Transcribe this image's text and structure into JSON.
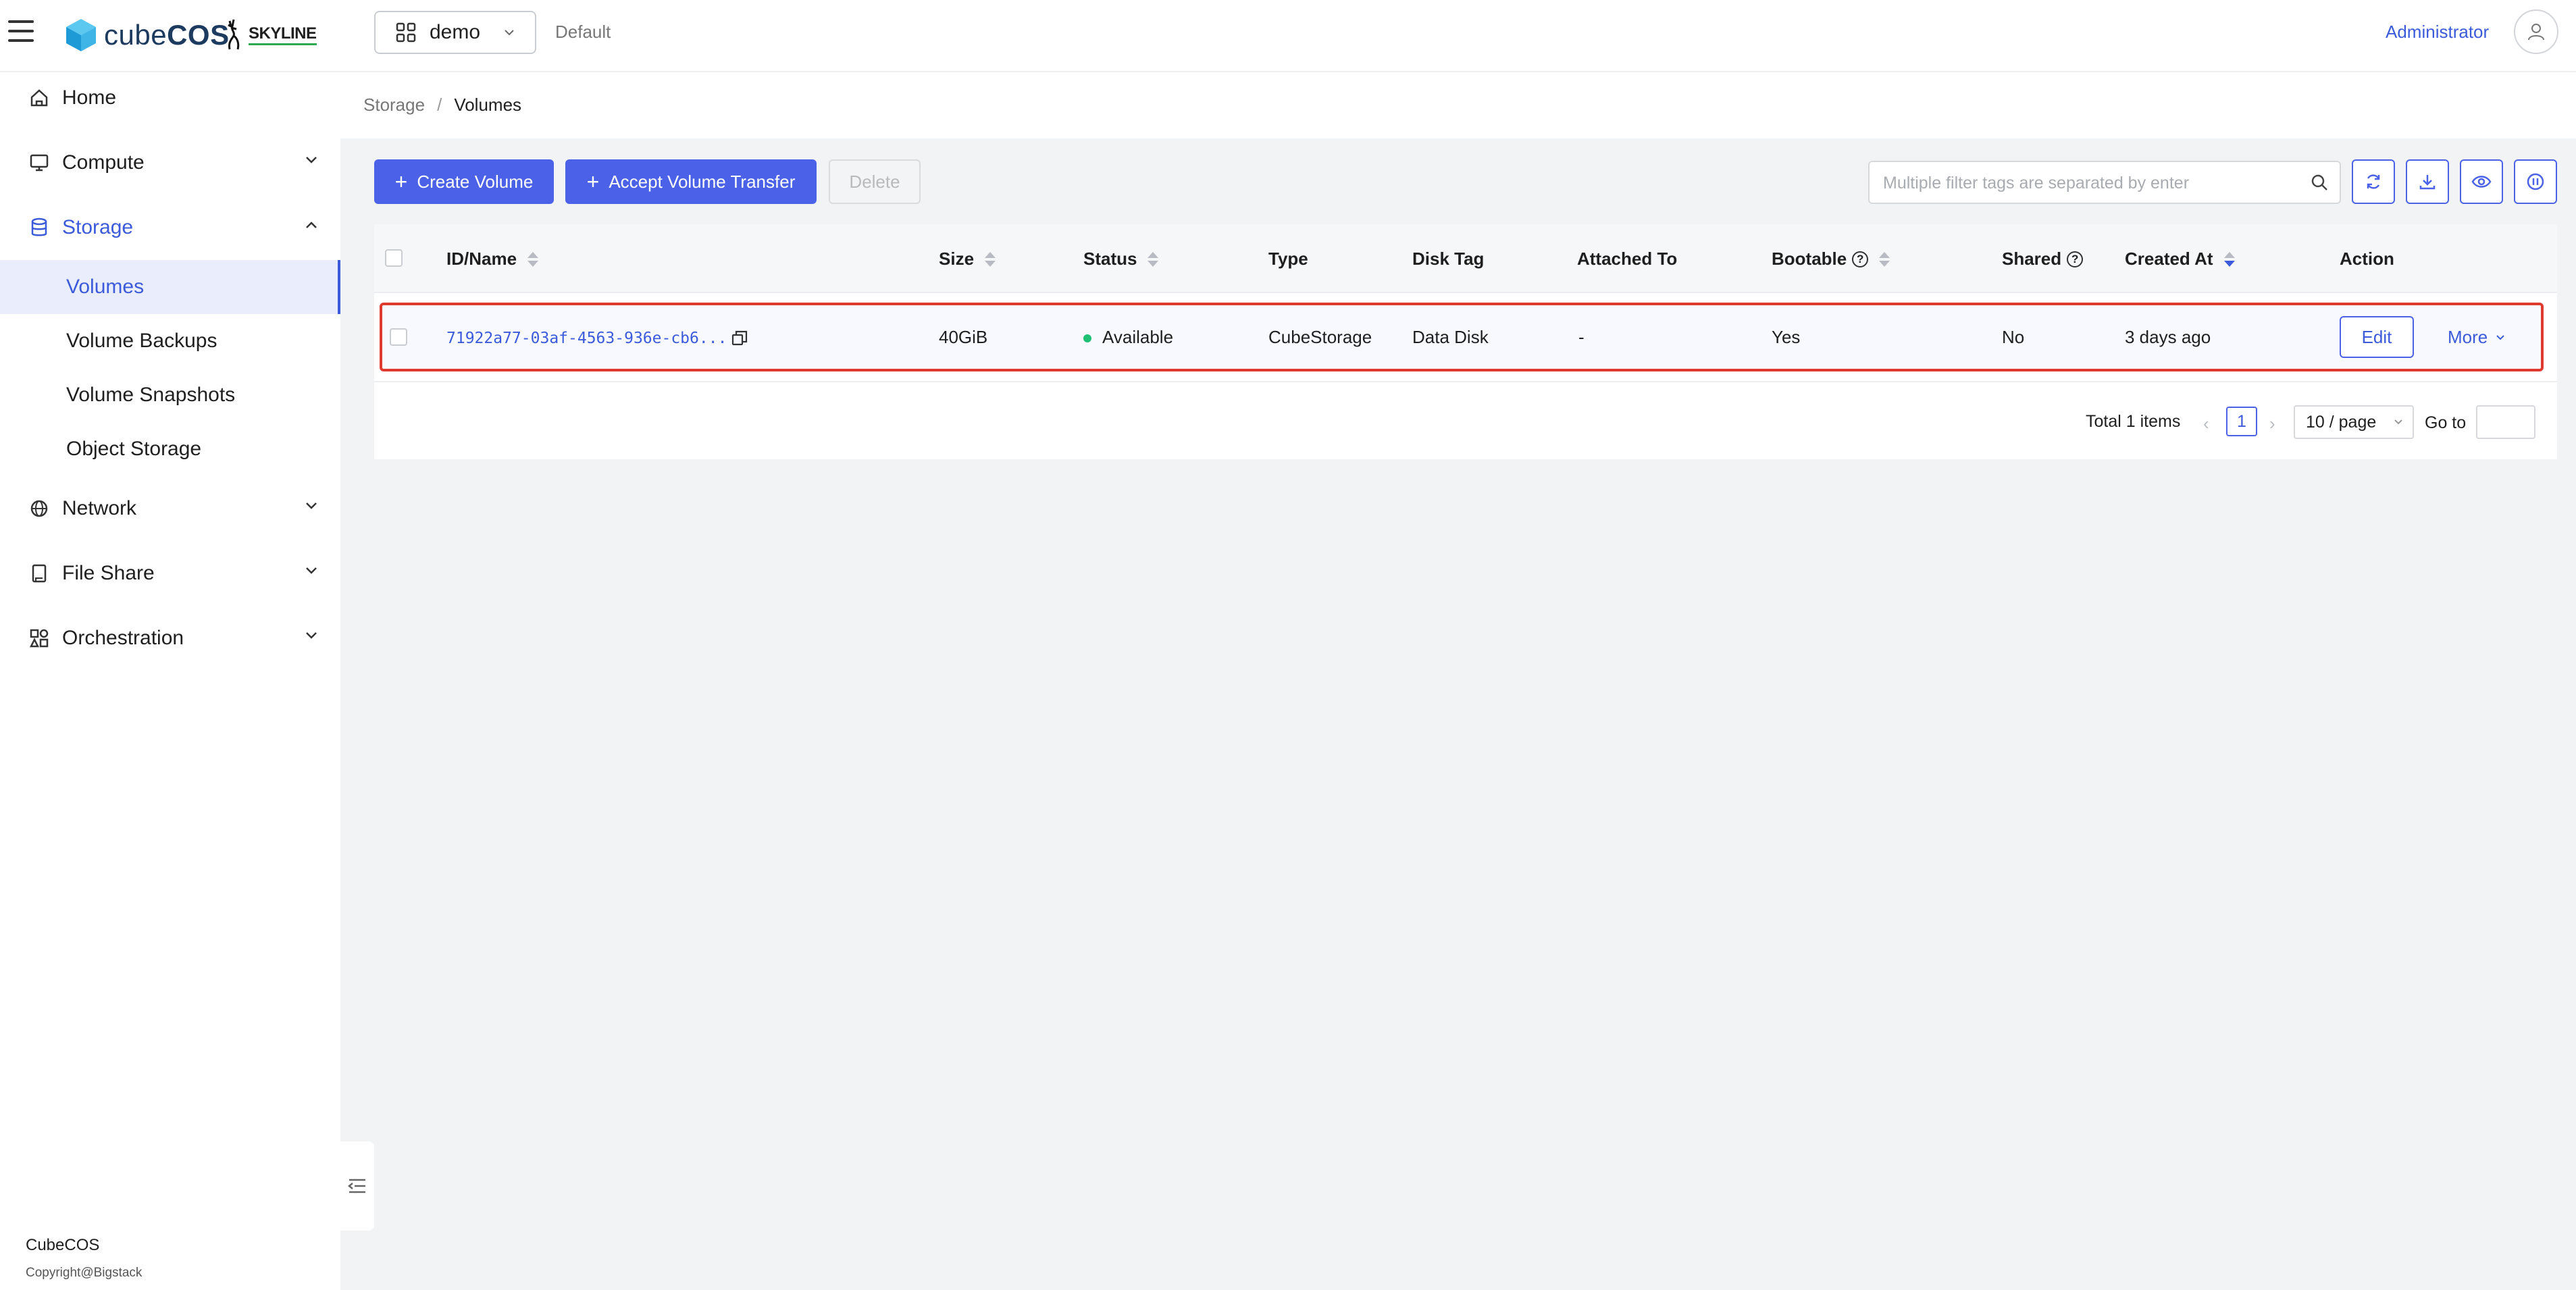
{
  "header": {
    "brand": "cubeCOS",
    "brand_plain": "cube",
    "brand_bold": "COS",
    "partner": "SKYLINE",
    "project": "demo",
    "domain": "Default",
    "user": "Administrator"
  },
  "sidebar": {
    "items": [
      {
        "label": "Home",
        "icon": "home-icon"
      },
      {
        "label": "Compute",
        "icon": "monitor-icon"
      },
      {
        "label": "Storage",
        "icon": "database-icon"
      },
      {
        "label": "Network",
        "icon": "globe-icon"
      },
      {
        "label": "File Share",
        "icon": "file-share-icon"
      },
      {
        "label": "Orchestration",
        "icon": "orchestration-icon"
      }
    ],
    "storage_sub": [
      "Volumes",
      "Volume Backups",
      "Volume Snapshots",
      "Object Storage"
    ],
    "footer_brand": "CubeCOS",
    "footer_copyright": "Copyright@Bigstack"
  },
  "breadcrumb": {
    "parent": "Storage",
    "separator": "/",
    "current": "Volumes"
  },
  "toolbar": {
    "create_label": "Create Volume",
    "accept_label": "Accept Volume Transfer",
    "delete_label": "Delete",
    "search_placeholder": "Multiple filter tags are separated by enter"
  },
  "table": {
    "columns": [
      "ID/Name",
      "Size",
      "Status",
      "Type",
      "Disk Tag",
      "Attached To",
      "Bootable",
      "Shared",
      "Created At",
      "Action"
    ],
    "rows": [
      {
        "id": "71922a77-03af-4563-936e-cb6...",
        "size": "40GiB",
        "status": "Available",
        "type": "CubeStorage",
        "disk_tag": "Data Disk",
        "attached_to": "-",
        "bootable": "Yes",
        "shared": "No",
        "created_at": "3 days ago",
        "edit_label": "Edit",
        "more_label": "More"
      }
    ]
  },
  "pagination": {
    "total": "Total 1 items",
    "current_page": "1",
    "page_size": "10 / page",
    "goto_label": "Go to"
  },
  "colors": {
    "primary": "#4b62e8",
    "highlight_border": "#e03a2f",
    "status_available": "#1fbf74"
  }
}
